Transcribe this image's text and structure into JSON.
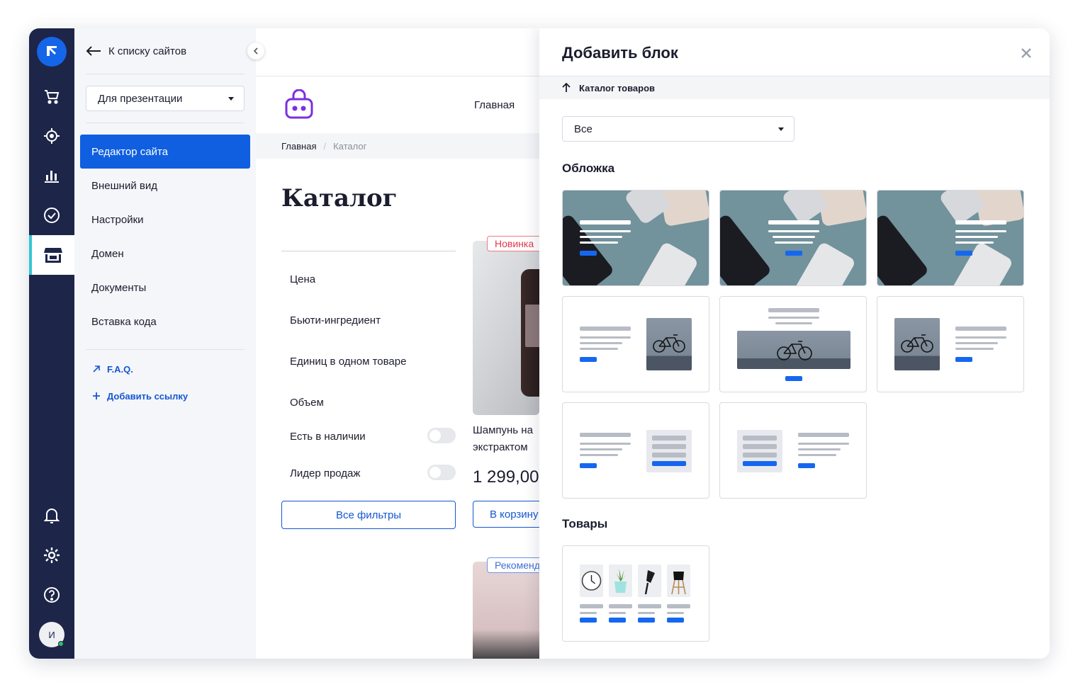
{
  "sidebar": {
    "back_label": "К списку сайтов",
    "site_select": "Для презентации",
    "menu": [
      {
        "label": "Редактор сайта",
        "active": true
      },
      {
        "label": "Внешний вид"
      },
      {
        "label": "Настройки"
      },
      {
        "label": "Домен"
      },
      {
        "label": "Документы"
      },
      {
        "label": "Вставка кода"
      }
    ],
    "faq_label": "F.A.Q.",
    "add_link_label": "Добавить ссылку"
  },
  "rail": {
    "items": [
      "shop-cart-icon",
      "target-icon",
      "bar-chart-icon",
      "check-circle-icon",
      "storefront-icon"
    ],
    "active": "storefront-icon",
    "bottom": [
      "bell-icon",
      "gear-icon",
      "help-icon"
    ],
    "avatar_initial": "И"
  },
  "preview": {
    "nav_label": "Главная",
    "breadcrumb": [
      "Главная",
      "Каталог"
    ],
    "page_title": "Каталог",
    "filters": [
      "Цена",
      "Бьюти-ингредиент",
      "Единиц в одном товаре",
      "Объем"
    ],
    "toggles": [
      "Есть в наличии",
      "Лидер продаж"
    ],
    "all_filters_label": "Все фильтры",
    "product": {
      "badge": "Новинка",
      "name_line1": "Шампунь на",
      "name_line2": "экстрактом",
      "price": "1 299,00",
      "cart_label": "В корзину"
    },
    "product2_badge": "Рекомендуем"
  },
  "panel": {
    "title": "Добавить блок",
    "breadcrumb": "Каталог товаров",
    "select_value": "Все",
    "sections": {
      "cover": "Обложка",
      "goods": "Товары"
    }
  },
  "colors": {
    "rail_bg": "#1d2549",
    "accent_blue": "#0f5fe0",
    "active_indicator": "#35c6d6",
    "badge_new": "#e2384d"
  }
}
